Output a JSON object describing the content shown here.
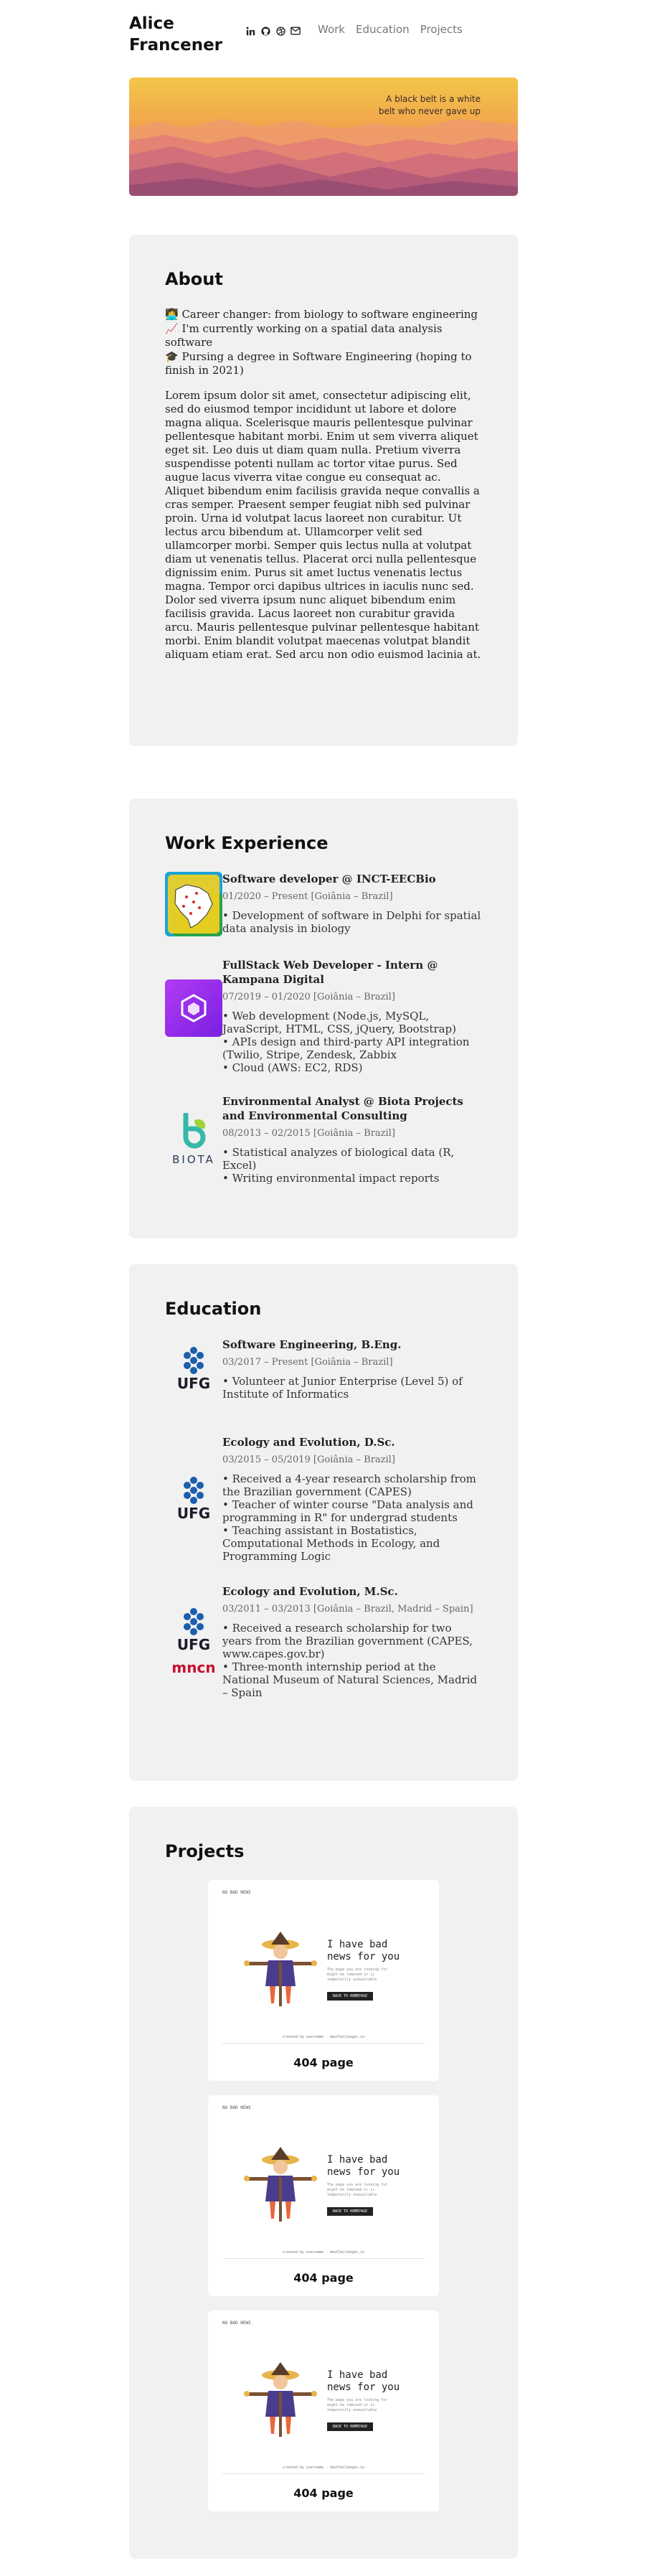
{
  "header": {
    "name": "Alice Francener",
    "social": [
      "linkedin-icon",
      "github-icon",
      "dribbble-icon",
      "mail-icon"
    ],
    "nav": [
      {
        "label": "Work"
      },
      {
        "label": "Education"
      },
      {
        "label": "Projects"
      }
    ]
  },
  "hero": {
    "quote": "A black belt is a white belt who never gave up"
  },
  "about": {
    "title": "About",
    "lines": [
      "👩‍💻 Career changer: from biology to software engineering",
      "📈 I'm currently working on a spatial data analysis software",
      "🎓 Pursing a degree in Software Engineering (hoping to finish in 2021)"
    ],
    "lorem": "Lorem ipsum dolor sit amet, consectetur adipiscing elit, sed do eiusmod tempor incididunt ut labore et dolore magna aliqua. Scelerisque mauris pellentesque pulvinar pellentesque habitant morbi. Enim ut sem viverra aliquet eget sit. Leo duis ut diam quam nulla. Pretium viverra suspendisse potenti nullam ac tortor vitae purus. Sed augue lacus viverra vitae congue eu consequat ac. Aliquet bibendum enim facilisis gravida neque convallis a cras semper. Praesent semper feugiat nibh sed pulvinar proin. Urna id volutpat lacus laoreet non curabitur. Ut lectus arcu bibendum at. Ullamcorper velit sed ullamcorper morbi. Semper quis lectus nulla at volutpat diam ut venenatis tellus. Placerat orci nulla pellentesque dignissim enim. Purus sit amet luctus venenatis lectus magna. Tempor orci dapibus ultrices in iaculis nunc sed. Dolor sed viverra ipsum nunc aliquet bibendum enim facilisis gravida. Lacus laoreet non curabitur gravida arcu. Mauris pellentesque pulvinar pellentesque habitant morbi. Enim blandit volutpat maecenas volutpat blandit aliquam etiam erat. Sed arcu non odio euismod lacinia at."
  },
  "work": {
    "title": "Work Experience",
    "items": [
      {
        "logo": "inct-map-logo",
        "title": "Software developer @ INCT-EECBio",
        "date": "01/2020 – Present [Goiânia – Brazil]",
        "bullets": [
          "• Development of software in Delphi for spatial data analysis in biology"
        ]
      },
      {
        "logo": "kampana-logo",
        "title": "FullStack Web Developer - Intern @ Kampana Digital",
        "date": "07/2019 – 01/2020 [Goiânia – Brazil]",
        "bullets": [
          "• Web development (Node.js, MySQL, JavaScript, HTML, CSS, jQuery, Bootstrap)",
          "• APIs design and third-party API integration (Twilio, Stripe, Zendesk, Zabbix",
          "• Cloud (AWS: EC2, RDS)"
        ]
      },
      {
        "logo": "biota-logo",
        "logo_text": "BIOTA",
        "title": "Environmental Analyst @ Biota Projects and Environmental Consulting",
        "date": "08/2013 – 02/2015 [Goiânia – Brazil]",
        "bullets": [
          "• Statistical analyzes of biological data (R, Excel)",
          "• Writing environmental impact reports"
        ]
      }
    ]
  },
  "education": {
    "title": "Education",
    "items": [
      {
        "logo": "ufg-logo",
        "logo_text": "UFG",
        "title": "Software Engineering, B.Eng.",
        "date": "03/2017 – Present [Goiânia – Brazil]",
        "bullets": [
          "• Volunteer at Junior Enterprise (Level 5) of Institute of Informatics"
        ]
      },
      {
        "logo": "ufg-logo",
        "logo_text": "UFG",
        "title": "Ecology and Evolution, D.Sc.",
        "date": "03/2015 – 05/2019 [Goiânia – Brazil]",
        "bullets": [
          "• Received a 4-year research scholarship from the Brazilian government (CAPES)",
          "• Teacher of winter course \"Data analysis and programming in R\" for undergrad students",
          "• Teaching assistant in Bostatistics, Computational Methods in Ecology, and Programming Logic"
        ]
      },
      {
        "logo": "ufg-logo",
        "logo_text": "UFG",
        "logo2_text": "mncn",
        "title": "Ecology and Evolution, M.Sc.",
        "date": "03/2011 – 03/2013 [Goiânia – Brazil, Madrid – Spain]",
        "bullets": [
          "• Received a research scholarship for two years from the Brazilian government (CAPES, www.capes.gov.br)",
          "• Three-month internship period at the National Museum of Natural Sciences, Madrid – Spain"
        ]
      }
    ]
  },
  "projects": {
    "title": "Projects",
    "items": [
      {
        "label": "404 page",
        "shot": {
          "corner": "NO BAD NEWS",
          "headline": "I have bad news for you",
          "sub": "The page you are looking for might be removed or is temporarily unavailable",
          "button": "BACK TO HOMEPAGE",
          "foot": "created by username - devChallenges.io"
        }
      },
      {
        "label": "404 page",
        "shot": {
          "corner": "NO BAD NEWS",
          "headline": "I have bad news for you",
          "sub": "The page you are looking for might be removed or is temporarily unavailable",
          "button": "BACK TO HOMEPAGE",
          "foot": "created by username - devChallenges.io"
        }
      },
      {
        "label": "404 page",
        "shot": {
          "corner": "NO BAD NEWS",
          "headline": "I have bad news for you",
          "sub": "The page you are looking for might be removed or is temporarily unavailable",
          "button": "BACK TO HOMEPAGE",
          "foot": "created by username - devChallenges.io"
        }
      }
    ]
  },
  "colors": {
    "card_bg": "#f1f1f1",
    "hero_top": "#f4c247",
    "hero_bottom": "#c06a78",
    "kampana": "#9b2cf0",
    "biota": "#36b8a8",
    "ufg": "#1b5fad",
    "mncn": "#c8102e"
  }
}
